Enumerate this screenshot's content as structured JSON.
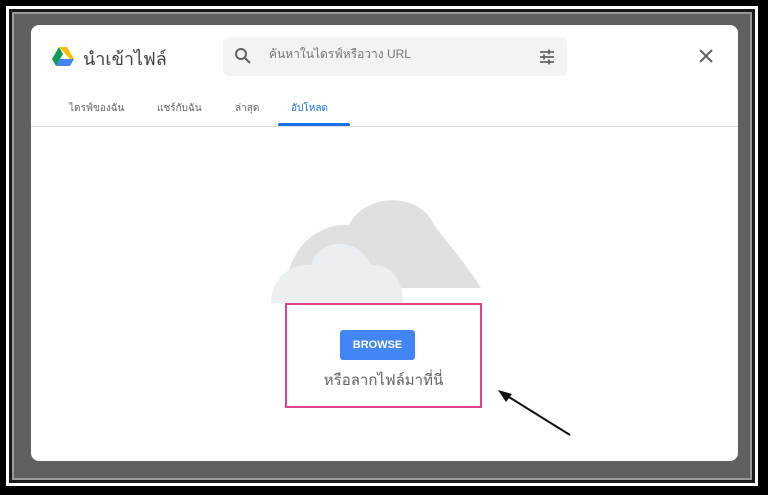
{
  "dialog": {
    "title": "นำเข้าไฟล์",
    "close_label": "×"
  },
  "search": {
    "placeholder": "ค้นหาในไดรฟ์หรือวาง URL"
  },
  "tabs": [
    {
      "label": "ไดรฟ์ของฉัน",
      "active": false
    },
    {
      "label": "แชร์กับฉัน",
      "active": false
    },
    {
      "label": "ล่าสุด",
      "active": false
    },
    {
      "label": "อัปโหลด",
      "active": true
    }
  ],
  "upload": {
    "browse_label": "BROWSE",
    "drop_text": "หรือลากไฟล์มาที่นี่"
  },
  "colors": {
    "accent": "#1a73e8",
    "browse_button": "#4285f4",
    "highlight_border": "#e0408f",
    "cloud_back": "#e0e0e0",
    "cloud_front": "#eceff1"
  },
  "icons": [
    "google-drive-icon",
    "search-icon",
    "tune-icon",
    "close-icon",
    "cloud-illustration",
    "arrow-annotation"
  ]
}
